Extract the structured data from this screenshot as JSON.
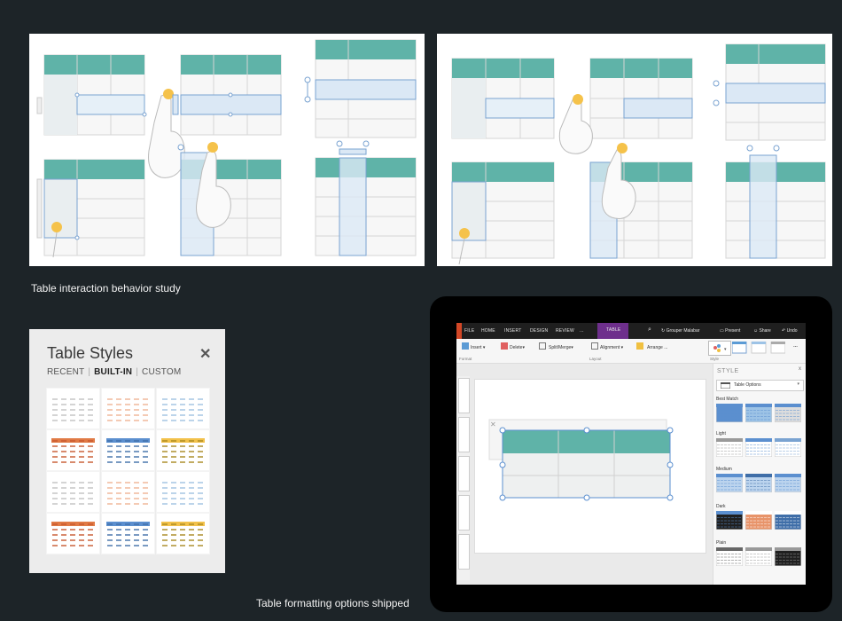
{
  "captions": {
    "interaction_study": "Table interaction behavior study",
    "formatting_shipped": "Table formatting options shipped"
  },
  "colors": {
    "teal_header": "#5fb3a8",
    "selection_blue": "#7aa3d1",
    "touch_yellow": "#f5c24a",
    "ribbon_dark": "#1f1f1f",
    "ribbon_table_tab": "#6e2f8c",
    "background": "#1d2428"
  },
  "table_styles_pane": {
    "title": "Table Styles",
    "close_icon": "close-icon",
    "tabs": [
      {
        "label": "RECENT",
        "active": false
      },
      {
        "label": "BUILT-IN",
        "active": true
      },
      {
        "label": "CUSTOM",
        "active": false
      }
    ],
    "thumbnails": [
      {
        "accent": "gray"
      },
      {
        "accent": "orange"
      },
      {
        "accent": "blue"
      },
      {
        "accent": "orange-header"
      },
      {
        "accent": "blue-header"
      },
      {
        "accent": "yellow-header"
      },
      {
        "accent": "gray"
      },
      {
        "accent": "orange"
      },
      {
        "accent": "blue"
      },
      {
        "accent": "orange-header"
      },
      {
        "accent": "blue-header"
      },
      {
        "accent": "yellow-header"
      }
    ]
  },
  "app": {
    "ribbon_tabs": [
      "FILE",
      "HOME",
      "INSERT",
      "DESIGN",
      "REVIEW",
      "..."
    ],
    "active_tab": "TABLE",
    "right_items": {
      "search_icon": "search-icon",
      "coauthor": "Grouper Malabar",
      "present": "Present",
      "share": "Share",
      "undo": "Undo"
    },
    "ribbon_buttons": {
      "insert": "Insert",
      "delete": "Delete",
      "split_merge": "Split/Merge",
      "alignment": "Alignment",
      "arrange": "Arrange",
      "more": "..."
    },
    "ribbon_groups": {
      "format": "Format",
      "layout": "Layout",
      "style": "Style"
    },
    "style_pane": {
      "title": "STYLE",
      "close": "x",
      "dropdown": "Table Options",
      "sections": [
        "Best Match",
        "Light",
        "Medium",
        "Dark",
        "Plain"
      ]
    }
  }
}
